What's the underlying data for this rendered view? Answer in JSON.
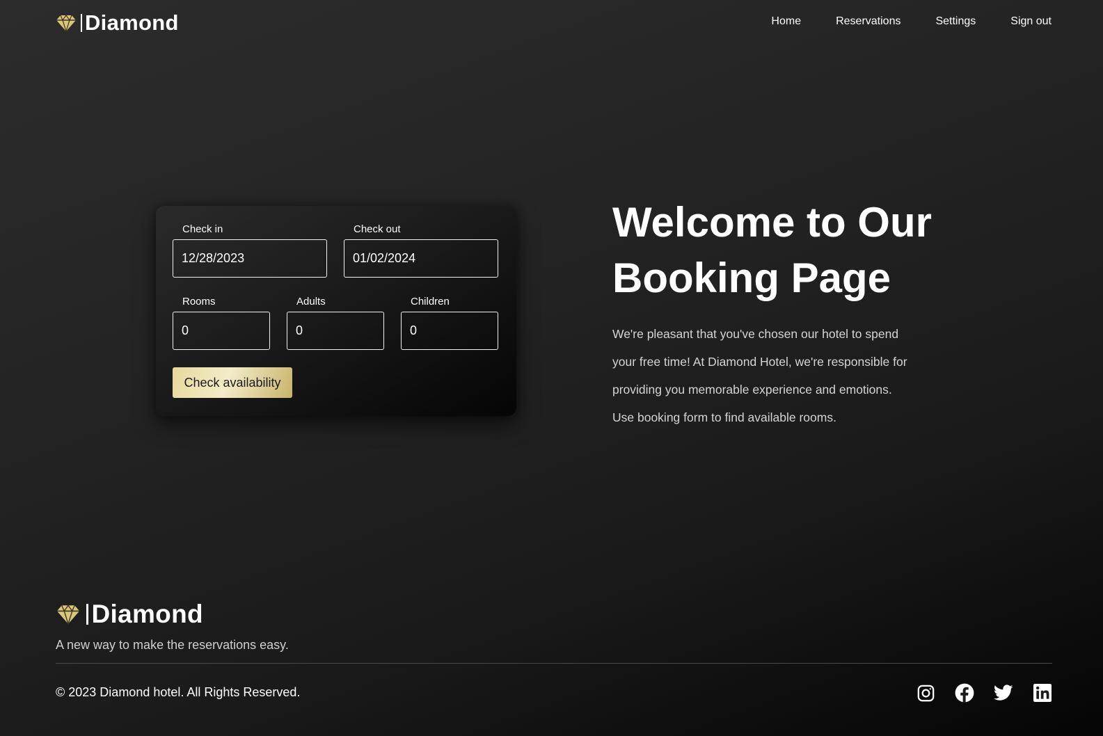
{
  "brand": {
    "name": "Diamond",
    "gold": "#d9c67a"
  },
  "nav": {
    "items": [
      "Home",
      "Reservations",
      "Settings",
      "Sign out"
    ]
  },
  "booking_form": {
    "check_in": {
      "label": "Check in",
      "value": "12/28/2023"
    },
    "check_out": {
      "label": "Check out",
      "value": "01/02/2024"
    },
    "rooms": {
      "label": "Rooms",
      "value": "0"
    },
    "adults": {
      "label": "Adults",
      "value": "0"
    },
    "children": {
      "label": "Children",
      "value": "0"
    },
    "submit_label": "Check availability"
  },
  "hero": {
    "title_lines": [
      "Welcome to Our",
      "Booking Page"
    ],
    "text_lines": [
      "We're pleasant that you've chosen our hotel to spend",
      "your free time! At Diamond Hotel, we're responsible for",
      "providing you memorable experience and emotions.",
      "Use booking form to find available rooms."
    ]
  },
  "footer": {
    "brand_name": "Diamond",
    "tagline": "A new way to make the reservations easy.",
    "copyright": "© 2023 Diamond hotel. All Rights Reserved.",
    "socials": [
      "instagram-icon",
      "facebook-icon",
      "twitter-icon",
      "linkedin-icon"
    ]
  }
}
